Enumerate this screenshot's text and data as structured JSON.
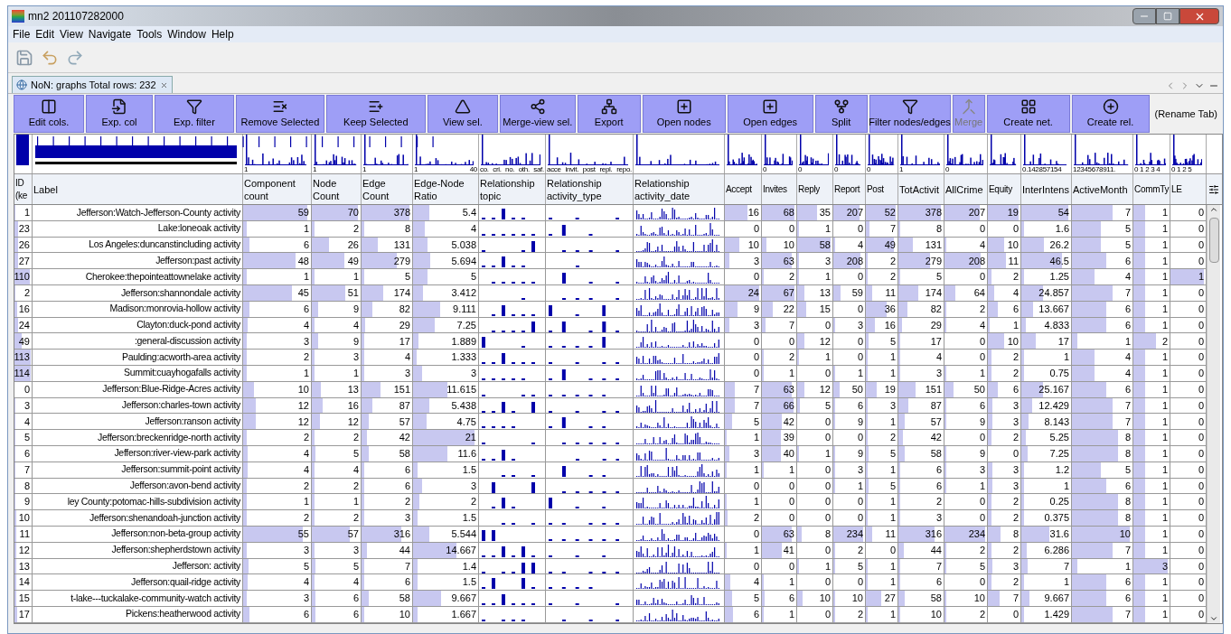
{
  "window": {
    "title": "mn2 201107282000"
  },
  "menu": [
    "File",
    "Edit",
    "View",
    "Navigate",
    "Tools",
    "Window",
    "Help"
  ],
  "tab": {
    "label": "NoN: graphs Total rows: 232",
    "selected": true
  },
  "buttons": [
    {
      "label": "Edit cols.",
      "disabled": false
    },
    {
      "label": "Exp. col",
      "disabled": false
    },
    {
      "label": "Exp. filter",
      "disabled": false
    },
    {
      "label": "Remove Selected",
      "disabled": false
    },
    {
      "label": "Keep Selected",
      "disabled": false
    },
    {
      "label": "View sel.",
      "disabled": false
    },
    {
      "label": "Merge-view sel.",
      "disabled": false
    },
    {
      "label": "Export",
      "disabled": false
    },
    {
      "label": "Open nodes",
      "disabled": false
    },
    {
      "label": "Open edges",
      "disabled": false
    },
    {
      "label": "Split",
      "disabled": false
    },
    {
      "label": "Filter nodes/edges",
      "disabled": false
    },
    {
      "label": "Merge",
      "disabled": true
    },
    {
      "label": "Create net.",
      "disabled": false
    },
    {
      "label": "Create rel.",
      "disabled": false
    }
  ],
  "rename_tab": "(Rename Tab)",
  "columns": [
    {
      "header": "ID (ke",
      "kind": "id"
    },
    {
      "header": "Label",
      "kind": "text"
    },
    {
      "header": "Component count",
      "kind": "number",
      "hist_labels": [
        "1"
      ]
    },
    {
      "header": "Node Count",
      "kind": "number",
      "hist_labels": [
        "1"
      ]
    },
    {
      "header": "Edge Count",
      "kind": "number",
      "hist_labels": [
        "1"
      ]
    },
    {
      "header": "Edge-Node Ratio",
      "kind": "number",
      "hist_labels": [
        "1",
        "40"
      ]
    },
    {
      "header": "Relationship topic",
      "kind": "spark",
      "hist_labels": [
        "co.",
        "cri.",
        "no.",
        "oth.",
        "saf."
      ]
    },
    {
      "header": "Relationship activity_type",
      "kind": "spark",
      "hist_labels": [
        "acce",
        "invit.",
        "post",
        "repl.",
        "repo."
      ]
    },
    {
      "header": "Relationship activity_date",
      "kind": "spark"
    },
    {
      "header": "Accept",
      "kind": "number"
    },
    {
      "header": "Invites",
      "kind": "number",
      "hist_labels": [
        "0"
      ]
    },
    {
      "header": "Reply",
      "kind": "number",
      "hist_labels": [
        "0"
      ]
    },
    {
      "header": "Report",
      "kind": "number",
      "hist_labels": [
        "0"
      ]
    },
    {
      "header": "Post",
      "kind": "number",
      "hist_labels": [
        "0"
      ]
    },
    {
      "header": "TotActivit",
      "kind": "number",
      "hist_labels": [
        "1"
      ]
    },
    {
      "header": "AllCrime",
      "kind": "number",
      "hist_labels": [
        "0"
      ]
    },
    {
      "header": "Equity",
      "kind": "number"
    },
    {
      "header": "InterIntens",
      "kind": "number",
      "hist_labels": [
        "0.142857154"
      ]
    },
    {
      "header": "ActiveMonth",
      "kind": "number",
      "hist_labels": [
        "12345678911."
      ]
    },
    {
      "header": "CommTy",
      "kind": "number",
      "hist_labels": [
        "0 1 2 3 4"
      ]
    },
    {
      "header": "LE",
      "kind": "number",
      "hist_labels": [
        "0 1 2 5"
      ]
    }
  ],
  "rows": [
    [
      "1",
      "Jefferson:Watch-Jefferson-County activity",
      "59",
      "70",
      "378",
      "5.4",
      "16",
      "68",
      "35",
      "207",
      "52",
      "378",
      "207",
      "19",
      "54",
      "7",
      "1",
      "0"
    ],
    [
      "23",
      "Lake:loneoak activity",
      "1",
      "2",
      "8",
      "4",
      "0",
      "0",
      "1",
      "0",
      "7",
      "8",
      "0",
      "0",
      "1.6",
      "5",
      "1",
      "0"
    ],
    [
      "26",
      "Los Angeles:duncanstincluding activity",
      "6",
      "26",
      "131",
      "5.038",
      "10",
      "10",
      "58",
      "4",
      "49",
      "131",
      "4",
      "10",
      "26.2",
      "5",
      "1",
      "0"
    ],
    [
      "27",
      "Jefferson:past activity",
      "48",
      "49",
      "279",
      "5.694",
      "3",
      "63",
      "3",
      "208",
      "2",
      "279",
      "208",
      "11",
      "46.5",
      "6",
      "1",
      "0"
    ],
    [
      "110",
      "Cherokee:thepointeattownelake activity",
      "1",
      "1",
      "5",
      "5",
      "0",
      "2",
      "1",
      "0",
      "2",
      "5",
      "0",
      "2",
      "1.25",
      "4",
      "1",
      "1"
    ],
    [
      "2",
      "Jefferson:shannondale activity",
      "45",
      "51",
      "174",
      "3.412",
      "24",
      "67",
      "13",
      "59",
      "11",
      "174",
      "64",
      "4",
      "24.857",
      "7",
      "1",
      "0"
    ],
    [
      "16",
      "Madison:monrovia-hollow activity",
      "6",
      "9",
      "82",
      "9.111",
      "9",
      "22",
      "15",
      "0",
      "36",
      "82",
      "2",
      "6",
      "13.667",
      "6",
      "1",
      "0"
    ],
    [
      "24",
      "Clayton:duck-pond activity",
      "4",
      "4",
      "29",
      "7.25",
      "3",
      "7",
      "0",
      "3",
      "16",
      "29",
      "4",
      "1",
      "4.833",
      "6",
      "1",
      "0"
    ],
    [
      "49",
      ":general-discussion activity",
      "3",
      "9",
      "17",
      "1.889",
      "0",
      "0",
      "12",
      "0",
      "5",
      "17",
      "0",
      "10",
      "17",
      "1",
      "2",
      "0"
    ],
    [
      "113",
      "Paulding:acworth-area activity",
      "2",
      "3",
      "4",
      "1.333",
      "0",
      "2",
      "1",
      "0",
      "1",
      "4",
      "0",
      "2",
      "1",
      "4",
      "1",
      "0"
    ],
    [
      "114",
      "Summit:cuayhogafalls activity",
      "1",
      "1",
      "3",
      "3",
      "0",
      "1",
      "0",
      "1",
      "1",
      "3",
      "1",
      "2",
      "0.75",
      "4",
      "1",
      "0"
    ],
    [
      "0",
      "Jefferson:Blue-Ridge-Acres activity",
      "10",
      "13",
      "151",
      "11.615",
      "7",
      "63",
      "12",
      "50",
      "19",
      "151",
      "50",
      "6",
      "25.167",
      "6",
      "1",
      "0"
    ],
    [
      "3",
      "Jefferson:charles-town activity",
      "12",
      "16",
      "87",
      "5.438",
      "7",
      "66",
      "5",
      "6",
      "3",
      "87",
      "6",
      "3",
      "12.429",
      "7",
      "1",
      "0"
    ],
    [
      "4",
      "Jefferson:ranson activity",
      "12",
      "12",
      "57",
      "4.75",
      "5",
      "42",
      "0",
      "9",
      "1",
      "57",
      "9",
      "3",
      "8.143",
      "7",
      "1",
      "0"
    ],
    [
      "5",
      "Jefferson:breckenridge-north activity",
      "2",
      "2",
      "42",
      "21",
      "1",
      "39",
      "0",
      "0",
      "2",
      "42",
      "0",
      "2",
      "5.25",
      "8",
      "1",
      "0"
    ],
    [
      "6",
      "Jefferson:river-view-park activity",
      "4",
      "5",
      "58",
      "11.6",
      "3",
      "40",
      "1",
      "9",
      "5",
      "58",
      "9",
      "0",
      "7.25",
      "8",
      "1",
      "0"
    ],
    [
      "7",
      "Jefferson:summit-point activity",
      "4",
      "4",
      "6",
      "1.5",
      "1",
      "1",
      "0",
      "3",
      "1",
      "6",
      "3",
      "3",
      "1.2",
      "5",
      "1",
      "0"
    ],
    [
      "8",
      "Jefferson:avon-bend activity",
      "2",
      "2",
      "6",
      "3",
      "0",
      "0",
      "0",
      "1",
      "5",
      "6",
      "1",
      "3",
      "1",
      "6",
      "1",
      "0"
    ],
    [
      "9",
      "ley County:potomac-hills-subdivision activity",
      "1",
      "1",
      "2",
      "2",
      "1",
      "0",
      "0",
      "0",
      "1",
      "2",
      "0",
      "2",
      "0.25",
      "8",
      "1",
      "0"
    ],
    [
      "10",
      "Jefferson:shenandoah-junction activity",
      "2",
      "2",
      "3",
      "1.5",
      "2",
      "0",
      "0",
      "0",
      "1",
      "3",
      "0",
      "2",
      "0.375",
      "8",
      "1",
      "0"
    ],
    [
      "11",
      "Jefferson:non-beta-group activity",
      "55",
      "57",
      "316",
      "5.544",
      "0",
      "63",
      "8",
      "234",
      "11",
      "316",
      "234",
      "8",
      "31.6",
      "10",
      "1",
      "0"
    ],
    [
      "12",
      "Jefferson:shepherdstown activity",
      "3",
      "3",
      "44",
      "14.667",
      "1",
      "41",
      "0",
      "2",
      "0",
      "44",
      "2",
      "2",
      "6.286",
      "7",
      "1",
      "0"
    ],
    [
      "13",
      "Jefferson: activity",
      "5",
      "5",
      "7",
      "1.4",
      "0",
      "0",
      "1",
      "5",
      "1",
      "7",
      "5",
      "3",
      "7",
      "1",
      "3",
      "0"
    ],
    [
      "14",
      "Jefferson:quail-ridge activity",
      "4",
      "4",
      "6",
      "1.5",
      "4",
      "1",
      "0",
      "0",
      "1",
      "6",
      "0",
      "2",
      "1",
      "6",
      "1",
      "0"
    ],
    [
      "15",
      "t-lake---tuckalake-community-watch activity",
      "3",
      "6",
      "58",
      "9.667",
      "5",
      "6",
      "10",
      "10",
      "27",
      "58",
      "10",
      "7",
      "9.667",
      "6",
      "1",
      "0"
    ],
    [
      "17",
      "Pickens:heatherwood activity",
      "6",
      "6",
      "10",
      "1.667",
      "6",
      "1",
      "0",
      "2",
      "1",
      "10",
      "2",
      "0",
      "1.429",
      "7",
      "1",
      "0"
    ]
  ]
}
